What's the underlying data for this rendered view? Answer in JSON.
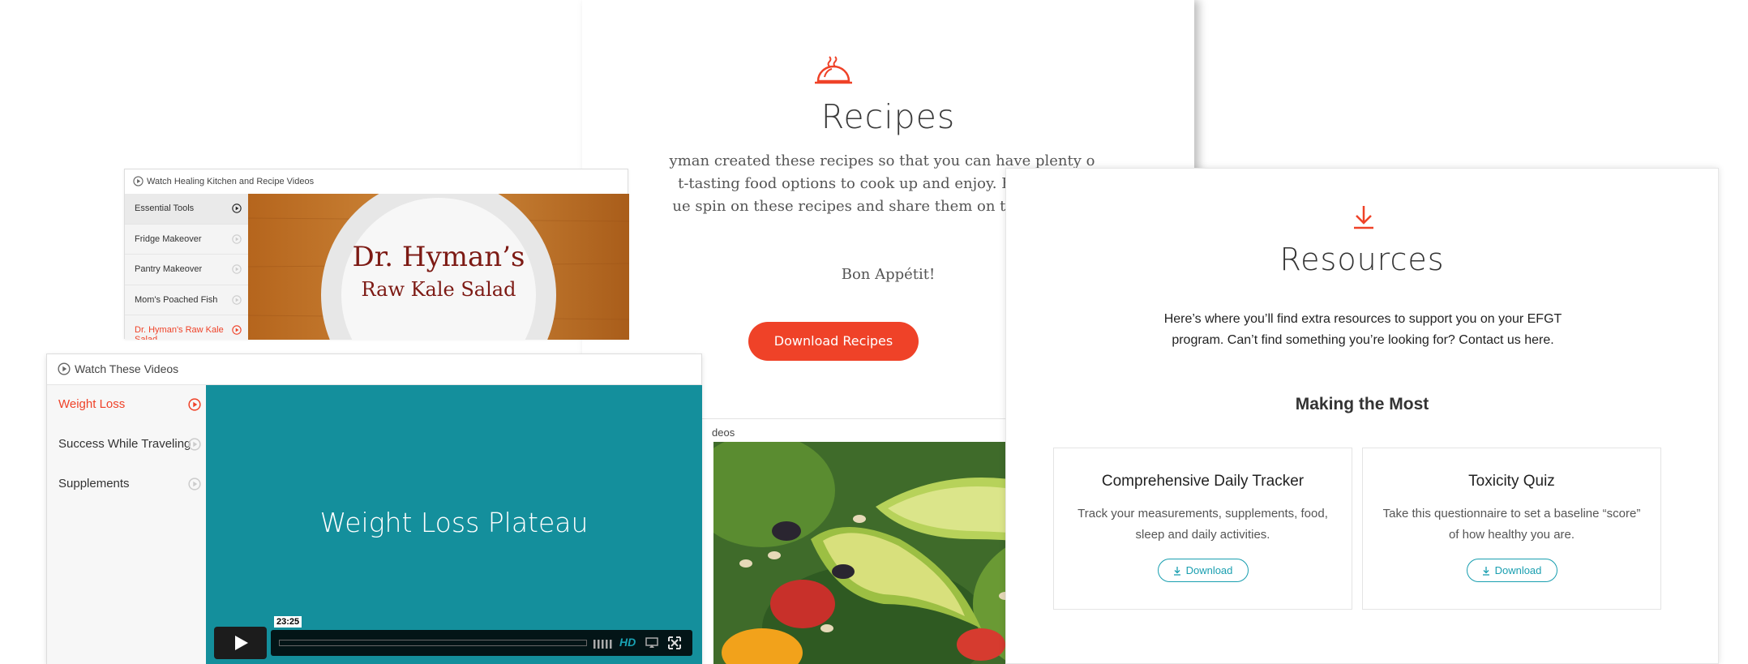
{
  "recipes": {
    "icon": "serving-dish-icon",
    "title": "Recipes",
    "body_line1": "yman created these recipes so that you can have plenty o",
    "body_line2": "t-tasting food options to cook up and enjoy. Feel free to",
    "body_line3": "ue spin on these recipes and share them on the commun",
    "closing": "Bon Appétit!",
    "download_button": "Download Recipes",
    "videos_label": "deos"
  },
  "kitchen_player": {
    "header": "Watch Healing Kitchen and Recipe Videos",
    "items": [
      {
        "label": "Essential Tools"
      },
      {
        "label": "Fridge Makeover"
      },
      {
        "label": "Pantry Makeover"
      },
      {
        "label": "Mom's Poached Fish"
      },
      {
        "label": "Dr. Hyman's Raw Kale Salad"
      }
    ],
    "video_title_line1": "Dr. Hyman’s",
    "video_title_line2": "Raw Kale Salad"
  },
  "videos_player": {
    "header": "Watch These Videos",
    "items": [
      {
        "label": "Weight Loss"
      },
      {
        "label": "Success While Traveling"
      },
      {
        "label": "Supplements"
      }
    ],
    "video_title": "Weight Loss Plateau",
    "time": "23:25",
    "hd_label": "HD"
  },
  "resources": {
    "icon": "download-arrow-icon",
    "title": "Resources",
    "intro_line1": "Here’s where you’ll find extra resources to support you on your EFGT",
    "intro_line2": "program. Can’t find something you’re looking for? Contact us here.",
    "subtitle": "Making the Most",
    "cards": [
      {
        "title": "Comprehensive Daily Tracker",
        "desc": "Track your measurements, supplements, food, sleep and daily activities.",
        "button": "Download"
      },
      {
        "title": "Toxicity Quiz",
        "desc": "Take this questionnaire to set a baseline “score” of how healthy you are.",
        "button": "Download"
      }
    ]
  },
  "colors": {
    "accent": "#ef4228",
    "teal": "#148f9c",
    "link_teal": "#1a9fb0"
  }
}
